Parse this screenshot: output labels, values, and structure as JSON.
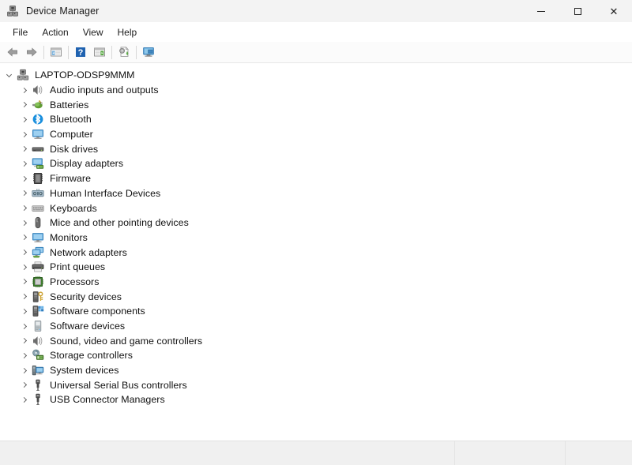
{
  "window": {
    "title": "Device Manager",
    "icon": "device-manager-icon",
    "controls": {
      "minimize": "–",
      "maximize": "☐",
      "close": "✕",
      "minimize_name": "minimize-button",
      "maximize_name": "maximize-button",
      "close_name": "close-button"
    }
  },
  "menubar": {
    "items": [
      {
        "label": "File",
        "name": "menu-file"
      },
      {
        "label": "Action",
        "name": "menu-action"
      },
      {
        "label": "View",
        "name": "menu-view"
      },
      {
        "label": "Help",
        "name": "menu-help"
      }
    ]
  },
  "toolbar": {
    "buttons": [
      {
        "icon": "back-arrow-icon",
        "tooltip": "Back"
      },
      {
        "icon": "forward-arrow-icon",
        "tooltip": "Forward"
      },
      {
        "icon": "show-hide-console-tree-icon",
        "tooltip": "Show/Hide Console Tree"
      },
      {
        "icon": "help-icon",
        "tooltip": "Help"
      },
      {
        "icon": "properties-icon",
        "tooltip": "Properties"
      },
      {
        "icon": "update-driver-icon",
        "tooltip": "Update Driver Software"
      },
      {
        "icon": "scan-hardware-icon",
        "tooltip": "Scan for hardware changes"
      }
    ]
  },
  "tree": {
    "root": {
      "label": "LAPTOP-ODSP9MMM",
      "icon": "computer-device-icon",
      "expanded": true
    },
    "nodes": [
      {
        "label": "Audio inputs and outputs",
        "icon": "speaker-icon",
        "expanded": false
      },
      {
        "label": "Batteries",
        "icon": "battery-icon",
        "expanded": false
      },
      {
        "label": "Bluetooth",
        "icon": "bluetooth-icon",
        "expanded": false
      },
      {
        "label": "Computer",
        "icon": "monitor-icon",
        "expanded": false
      },
      {
        "label": "Disk drives",
        "icon": "disk-drive-icon",
        "expanded": false
      },
      {
        "label": "Display adapters",
        "icon": "display-adapter-icon",
        "expanded": false
      },
      {
        "label": "Firmware",
        "icon": "firmware-chip-icon",
        "expanded": false
      },
      {
        "label": "Human Interface Devices",
        "icon": "hid-icon",
        "expanded": false
      },
      {
        "label": "Keyboards",
        "icon": "keyboard-icon",
        "expanded": false
      },
      {
        "label": "Mice and other pointing devices",
        "icon": "mouse-icon",
        "expanded": false
      },
      {
        "label": "Monitors",
        "icon": "monitor-icon",
        "expanded": false
      },
      {
        "label": "Network adapters",
        "icon": "network-adapter-icon",
        "expanded": false
      },
      {
        "label": "Print queues",
        "icon": "printer-icon",
        "expanded": false
      },
      {
        "label": "Processors",
        "icon": "processor-icon",
        "expanded": false
      },
      {
        "label": "Security devices",
        "icon": "security-key-icon",
        "expanded": false
      },
      {
        "label": "Software components",
        "icon": "software-component-icon",
        "expanded": false
      },
      {
        "label": "Software devices",
        "icon": "software-device-icon",
        "expanded": false
      },
      {
        "label": "Sound, video and game controllers",
        "icon": "speaker-icon",
        "expanded": false
      },
      {
        "label": "Storage controllers",
        "icon": "storage-controller-icon",
        "expanded": false
      },
      {
        "label": "System devices",
        "icon": "system-device-icon",
        "expanded": false
      },
      {
        "label": "Universal Serial Bus controllers",
        "icon": "usb-icon",
        "expanded": false
      },
      {
        "label": "USB Connector Managers",
        "icon": "usb-icon",
        "expanded": false
      }
    ]
  },
  "statusbar": {
    "pane1": "",
    "pane2": "",
    "pane3": ""
  },
  "colors": {
    "titlebar_bg": "#f3f3f3",
    "toolbar_bg": "#fbfbfb",
    "body_bg": "#ffffff",
    "statusbar_bg": "#f0f0f0",
    "text": "#111111",
    "accent_blue": "#2196e3",
    "accent_green": "#5bab2d",
    "close_hover": "#c42b1c"
  }
}
